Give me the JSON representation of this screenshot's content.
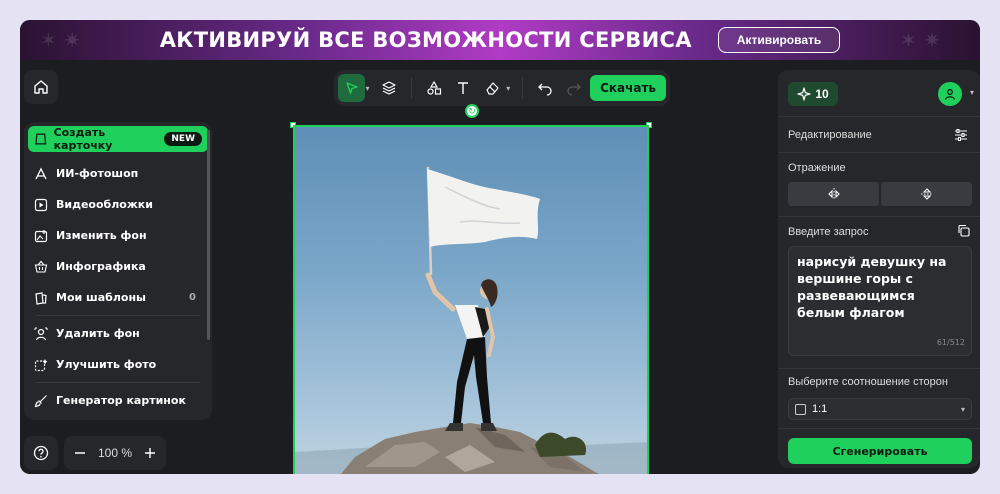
{
  "banner": {
    "text": "АКТИВИРУЙ ВСЕ ВОЗМОЖНОСТИ СЕРВИСА",
    "button": "Активировать"
  },
  "toolbar": {
    "download_label": "Скачать",
    "tools": [
      "select-icon",
      "layers-icon",
      "shapes-icon",
      "text-icon",
      "eraser-icon",
      "undo-icon",
      "redo-icon"
    ]
  },
  "sidebar": {
    "create_card": {
      "label": "Создать карточку",
      "badge": "NEW"
    },
    "items": [
      {
        "label": "ИИ-фотошоп",
        "icon": "ai-photoshop-icon"
      },
      {
        "label": "Видеообложки",
        "icon": "video-icon"
      },
      {
        "label": "Изменить фон",
        "icon": "background-icon"
      },
      {
        "label": "Инфографика",
        "icon": "basket-icon"
      },
      {
        "label": "Мои шаблоны",
        "icon": "templates-icon",
        "count": "0"
      },
      {
        "label": "Удалить фон",
        "icon": "remove-bg-icon"
      },
      {
        "label": "Улучшить фото",
        "icon": "enhance-icon"
      },
      {
        "label": "Генератор картинок",
        "icon": "brush-icon"
      }
    ]
  },
  "zoom": {
    "value": "100",
    "unit": "%"
  },
  "right_panel": {
    "credits": "10",
    "editing_label": "Редактирование",
    "reflection_label": "Отражение",
    "prompt_label": "Введите запрос",
    "prompt_text": "нарисуй девушку на вершине горы с развевающимся белым флагом",
    "prompt_counter": "61/512",
    "ratio_label": "Выберите соотношение сторон",
    "ratio_value": "1:1",
    "generate_label": "Сгенерировать"
  },
  "colors": {
    "accent": "#1fd15c",
    "background": "#1c1d20",
    "panel": "#26272b"
  }
}
